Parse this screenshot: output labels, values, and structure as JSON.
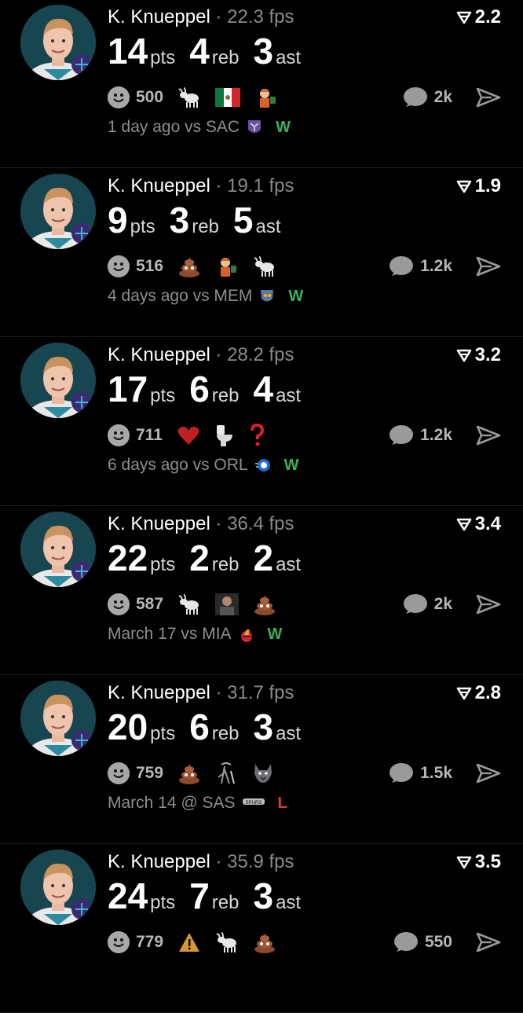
{
  "player_name": "K. Knueppel",
  "separator": "·",
  "units": {
    "pts": "pts",
    "reb": "reb",
    "ast": "ast"
  },
  "colors": {
    "win": "#3ab15a",
    "loss": "#e03a3a",
    "muted": "#8e8e8e"
  },
  "games": [
    {
      "fps": "22.3 fps",
      "score": "2.2",
      "pts": "14",
      "reb": "4",
      "ast": "3",
      "reactions": "500",
      "emojis": [
        "goat",
        "mexico-flag",
        "fry-meme"
      ],
      "comments": "2k",
      "meta": "1 day ago vs SAC",
      "team_logo": "kings-logo",
      "result": "W"
    },
    {
      "fps": "19.1 fps",
      "score": "1.9",
      "pts": "9",
      "reb": "3",
      "ast": "5",
      "reactions": "516",
      "emojis": [
        "poop",
        "fry-meme",
        "goat"
      ],
      "comments": "1.2k",
      "meta": "4 days ago vs MEM",
      "team_logo": "grizzlies-logo",
      "result": "W"
    },
    {
      "fps": "28.2 fps",
      "score": "3.2",
      "pts": "17",
      "reb": "6",
      "ast": "4",
      "reactions": "711",
      "emojis": [
        "heart",
        "toilet",
        "question"
      ],
      "comments": "1.2k",
      "meta": "6 days ago vs ORL",
      "team_logo": "magic-logo",
      "result": "W"
    },
    {
      "fps": "36.4 fps",
      "score": "3.4",
      "pts": "22",
      "reb": "2",
      "ast": "2",
      "reactions": "587",
      "emojis": [
        "goat",
        "person-photo",
        "poop"
      ],
      "comments": "2k",
      "meta": "March 17 vs MIA",
      "team_logo": "heat-logo",
      "result": "W"
    },
    {
      "fps": "31.7 fps",
      "score": "2.8",
      "pts": "20",
      "reb": "6",
      "ast": "3",
      "reactions": "759",
      "emojis": [
        "poop",
        "cane-figure",
        "wolf"
      ],
      "comments": "1.5k",
      "meta": "March 14 @ SAS",
      "team_logo": "spurs-logo",
      "result": "L"
    },
    {
      "fps": "35.9 fps",
      "score": "3.5",
      "pts": "24",
      "reb": "7",
      "ast": "3",
      "reactions": "779",
      "emojis": [
        "warning",
        "goat",
        "poop"
      ],
      "comments": "550",
      "meta": "",
      "team_logo": "",
      "result": ""
    }
  ]
}
